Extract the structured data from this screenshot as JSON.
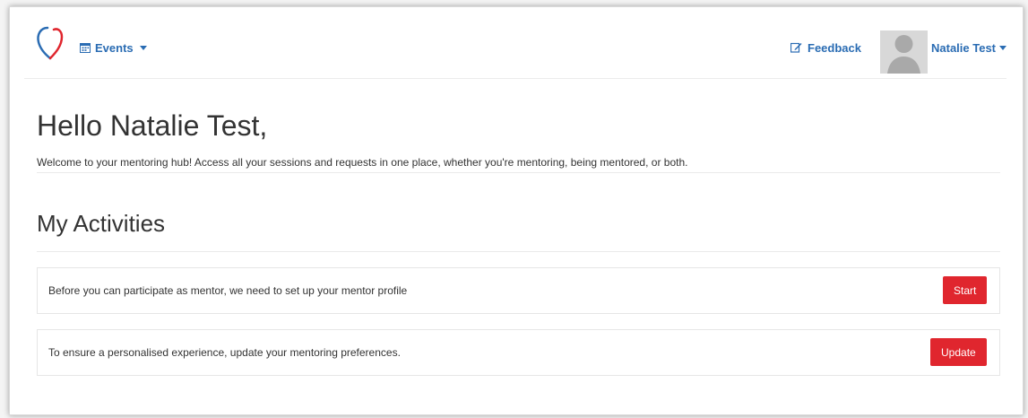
{
  "navbar": {
    "events_label": "Events",
    "feedback_label": "Feedback",
    "user_label": "Natalie Test"
  },
  "main": {
    "greeting": "Hello Natalie Test,",
    "welcome": "Welcome to your mentoring hub! Access all your sessions and requests in one place, whether you're mentoring, being mentored, or both.",
    "activities_title": "My Activities",
    "activities": [
      {
        "text": "Before you can participate as mentor, we need to set up your mentor profile",
        "button": "Start"
      },
      {
        "text": "To ensure a personalised experience, update your mentoring preferences.",
        "button": "Update"
      }
    ]
  },
  "colors": {
    "link": "#2a6cb3",
    "button": "#e0262e",
    "logo_blue": "#2a6cb3",
    "logo_red": "#e0262e"
  }
}
